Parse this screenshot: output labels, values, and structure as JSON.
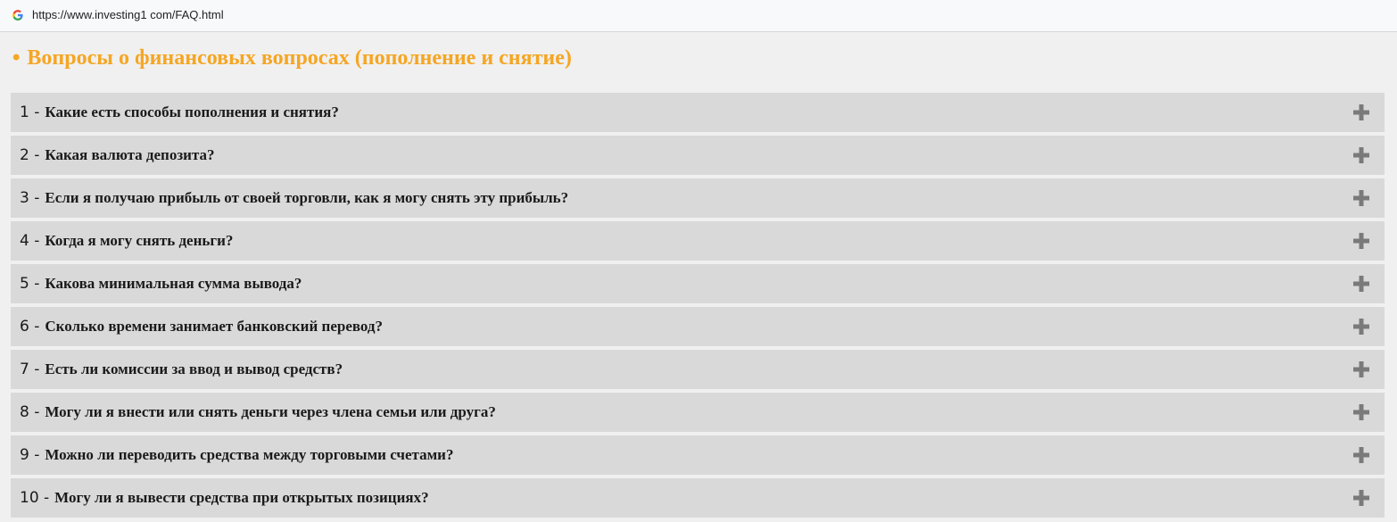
{
  "browser": {
    "url": "https://www.investing1 com/FAQ.html",
    "favicon_icon": "google-g-icon"
  },
  "section": {
    "bullet": "•",
    "title": "Вопросы о финансовых вопросах (пополнение и снятие)",
    "title_color": "#f5a623"
  },
  "faq": [
    {
      "num": "1 -",
      "question": "Какие есть способы пополнения и снятия?"
    },
    {
      "num": "2 -",
      "question": "Какая валюта депозита?"
    },
    {
      "num": "3 -",
      "question": "Если я получаю прибыль от своей торговли, как я могу снять эту прибыль?"
    },
    {
      "num": "4 -",
      "question": "Когда я могу снять деньги?"
    },
    {
      "num": "5 -",
      "question": "Какова минимальная сумма вывода?"
    },
    {
      "num": "6 -",
      "question": "Сколько времени занимает банковский перевод?"
    },
    {
      "num": "7 -",
      "question": "Есть ли комиссии за ввод и вывод средств?"
    },
    {
      "num": "8 -",
      "question": "Могу ли я внести или снять деньги через члена семьи или друга?"
    },
    {
      "num": "9 -",
      "question": "Можно ли переводить средства между торговыми счетами?"
    },
    {
      "num": "10 -",
      "question": "Могу ли я вывести средства при открытых позициях?"
    }
  ],
  "expand_icon": "plus-icon"
}
